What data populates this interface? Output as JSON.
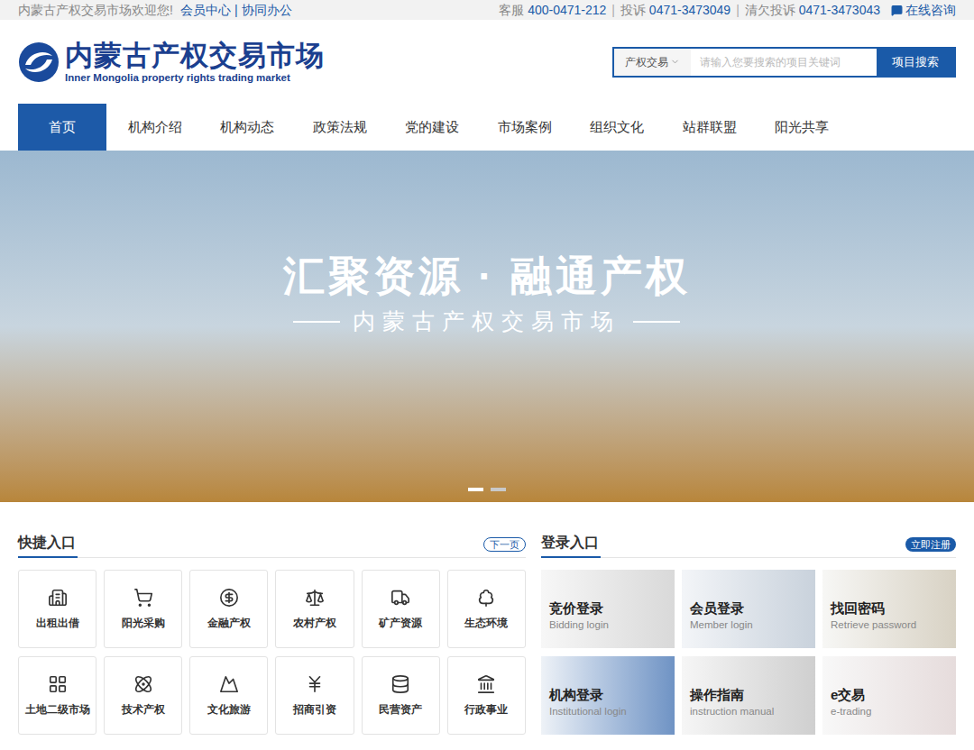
{
  "topbar": {
    "welcome": "内蒙古产权交易市场欢迎您!",
    "links": [
      "会员中心",
      "协同办公"
    ],
    "separator": "|",
    "contacts": [
      {
        "label": "客服",
        "value": "400-0471-212"
      },
      {
        "label": "投诉",
        "value": "0471-3473049"
      },
      {
        "label": "清欠投诉",
        "value": "0471-3473043"
      }
    ],
    "consult": "在线咨询"
  },
  "logo": {
    "name": "内蒙古产权交易市场",
    "english": "Inner Mongolia property rights trading market"
  },
  "search": {
    "category": "产权交易",
    "placeholder": "请输入您要搜索的项目关键词",
    "button": "项目搜索"
  },
  "nav": [
    {
      "label": "首页",
      "selected": true
    },
    {
      "label": "机构介绍",
      "selected": false
    },
    {
      "label": "机构动态",
      "selected": false
    },
    {
      "label": "政策法规",
      "selected": false
    },
    {
      "label": "党的建设",
      "selected": false
    },
    {
      "label": "市场案例",
      "selected": false
    },
    {
      "label": "组织文化",
      "selected": false
    },
    {
      "label": "站群联盟",
      "selected": false
    },
    {
      "label": "阳光共享",
      "selected": false
    }
  ],
  "banner": {
    "title": "汇聚资源 · 融通产权",
    "subtitle": "内蒙古产权交易市场",
    "dots": [
      {
        "selected": true
      },
      {
        "selected": false
      }
    ]
  },
  "quick": {
    "title": "快捷入口",
    "more": "下一页",
    "items": [
      "出租出借",
      "阳光采购",
      "金融产权",
      "农村产权",
      "矿产资源",
      "生态环境",
      "土地二级市场",
      "技术产权",
      "文化旅游",
      "招商引资",
      "民营资产",
      "行政事业"
    ]
  },
  "login": {
    "title": "登录入口",
    "register": "立即注册",
    "items": [
      {
        "title": "竞价登录",
        "subtitle": "Bidding login"
      },
      {
        "title": "会员登录",
        "subtitle": "Member login"
      },
      {
        "title": "找回密码",
        "subtitle": "Retrieve password"
      },
      {
        "title": "机构登录",
        "subtitle": "Institutional login"
      },
      {
        "title": "操作指南",
        "subtitle": "instruction manual"
      },
      {
        "title": "e交易",
        "subtitle": "e-trading"
      }
    ]
  }
}
